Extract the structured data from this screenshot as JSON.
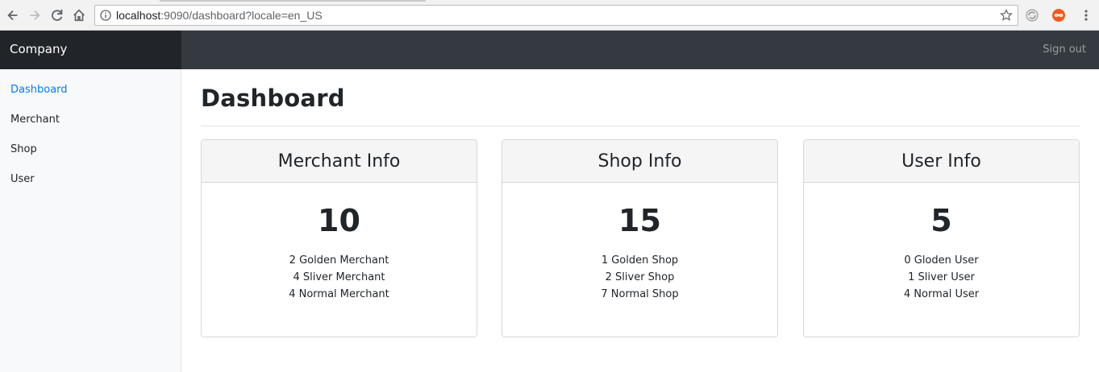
{
  "browser": {
    "url_host": "localhost",
    "url_rest": ":9090/dashboard?locale=en_US",
    "icons": [
      "back-icon",
      "forward-icon",
      "reload-icon",
      "home-icon",
      "info-icon",
      "star-icon",
      "extension-icon",
      "infinity-extension-icon",
      "menu-dots-icon"
    ]
  },
  "topbar": {
    "brand": "Company",
    "signout_label": "Sign out",
    "colors": {
      "brand_bg": "#212529",
      "bar_bg": "#343a40"
    }
  },
  "sidebar": {
    "items": [
      {
        "label": "Dashboard",
        "active": true
      },
      {
        "label": "Merchant",
        "active": false
      },
      {
        "label": "Shop",
        "active": false
      },
      {
        "label": "User",
        "active": false
      }
    ],
    "active_color": "#007bff"
  },
  "main": {
    "title": "Dashboard",
    "cards": [
      {
        "title": "Merchant Info",
        "count": "10",
        "lines": [
          "2 Golden Merchant",
          "4 Sliver Merchant",
          "4 Normal Merchant"
        ]
      },
      {
        "title": "Shop Info",
        "count": "15",
        "lines": [
          "1 Golden Shop",
          "2 Sliver Shop",
          "7 Normal Shop"
        ]
      },
      {
        "title": "User Info",
        "count": "5",
        "lines": [
          "0 Gloden User",
          "1 Sliver User",
          "4 Normal User"
        ]
      }
    ]
  }
}
